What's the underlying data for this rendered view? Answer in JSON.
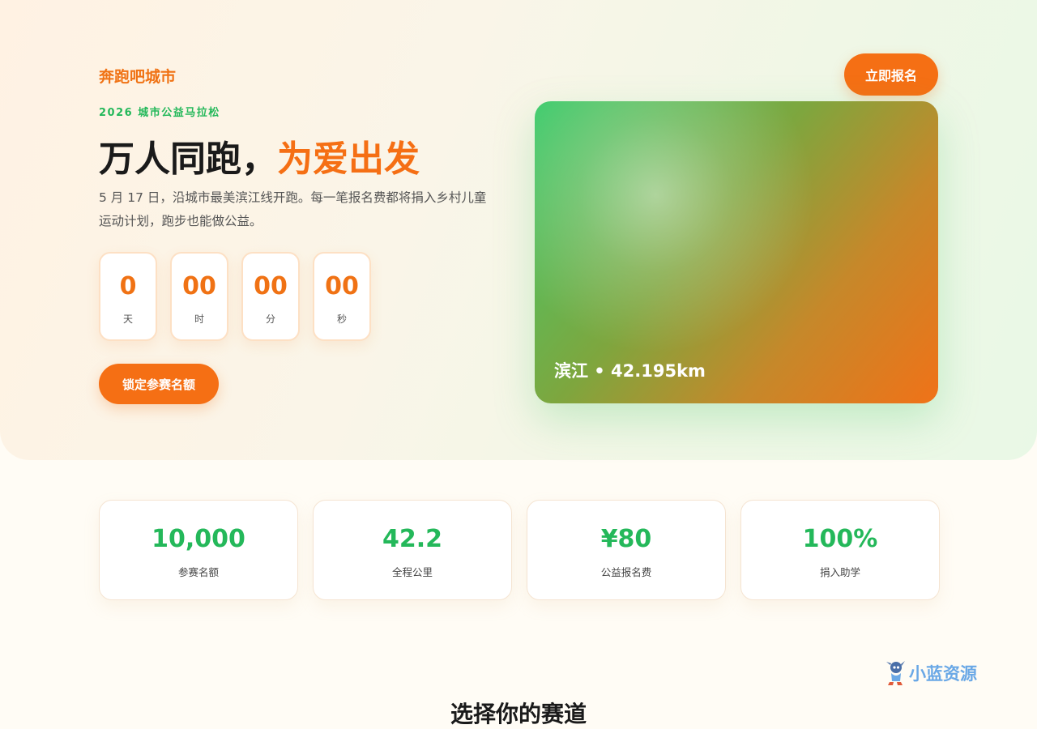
{
  "header": {
    "brand": "奔跑吧城市",
    "cta_label": "立即报名"
  },
  "hero": {
    "eyebrow": "2026 城市公益马拉松",
    "headline_main": "万人同跑，",
    "headline_accent": "为爱出发",
    "description": "5 月 17 日，沿城市最美滨江线开跑。每一笔报名费都将捐入乡村儿童运动计划，跑步也能做公益。",
    "countdown": [
      {
        "value": "0",
        "unit": "天"
      },
      {
        "value": "00",
        "unit": "时"
      },
      {
        "value": "00",
        "unit": "分"
      },
      {
        "value": "00",
        "unit": "秒"
      }
    ],
    "cta_label": "锁定参赛名额",
    "route_card_label": "滨江 • 42.195km"
  },
  "stats": [
    {
      "value": "10,000",
      "label": "参赛名额"
    },
    {
      "value": "42.2",
      "label": "全程公里"
    },
    {
      "value": "¥80",
      "label": "公益报名费"
    },
    {
      "value": "100%",
      "label": "捐入助学"
    }
  ],
  "watermark": {
    "text": "小蓝资源",
    "icon": "mascot-icon"
  },
  "section": {
    "title": "选择你的赛道"
  },
  "colors": {
    "accent_orange": "#f56f14",
    "accent_green": "#24b85a"
  }
}
